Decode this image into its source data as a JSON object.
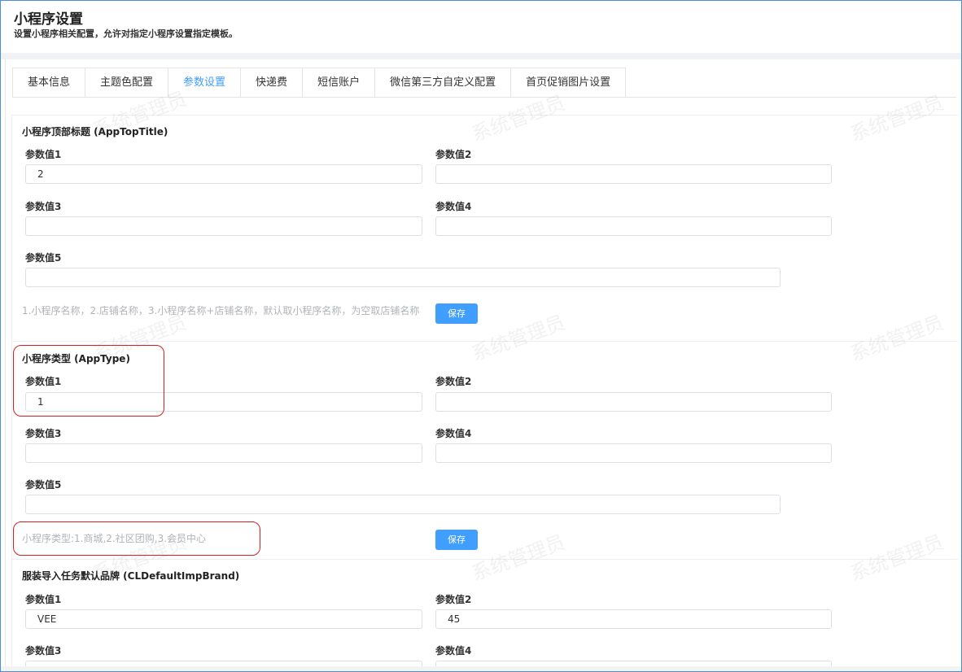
{
  "header": {
    "title": "小程序设置",
    "subtitle": "设置小程序相关配置，允许对指定小程序设置指定模板。"
  },
  "tabs": [
    {
      "label": "基本信息",
      "active": false
    },
    {
      "label": "主题色配置",
      "active": false
    },
    {
      "label": "参数设置",
      "active": true
    },
    {
      "label": "快递费",
      "active": false
    },
    {
      "label": "短信账户",
      "active": false
    },
    {
      "label": "微信第三方自定义配置",
      "active": false
    },
    {
      "label": "首页促销图片设置",
      "active": false
    }
  ],
  "labels": {
    "param1": "参数值1",
    "param2": "参数值2",
    "param3": "参数值3",
    "param4": "参数值4",
    "param5": "参数值5",
    "save": "保存"
  },
  "sections": [
    {
      "title": "小程序顶部标题 (AppTopTitle)",
      "values": [
        "2",
        "",
        "",
        "",
        ""
      ],
      "hint": "1.小程序名称，2.店铺名称，3.小程序名称+店铺名称，默认取小程序名称，为空取店铺名称"
    },
    {
      "title": "小程序类型 (AppType)",
      "values": [
        "1",
        "",
        "",
        "",
        ""
      ],
      "hint": "小程序类型:1.商城,2.社区团购,3.会员中心"
    },
    {
      "title": "服装导入任务默认品牌 (CLDefaultImpBrand)",
      "values": [
        "VEE",
        "45",
        "",
        ""
      ]
    }
  ],
  "watermark": "系统管理员",
  "colors": {
    "accent": "#409eff",
    "highlight": "#d42020",
    "hint": "#b0b3b8"
  }
}
